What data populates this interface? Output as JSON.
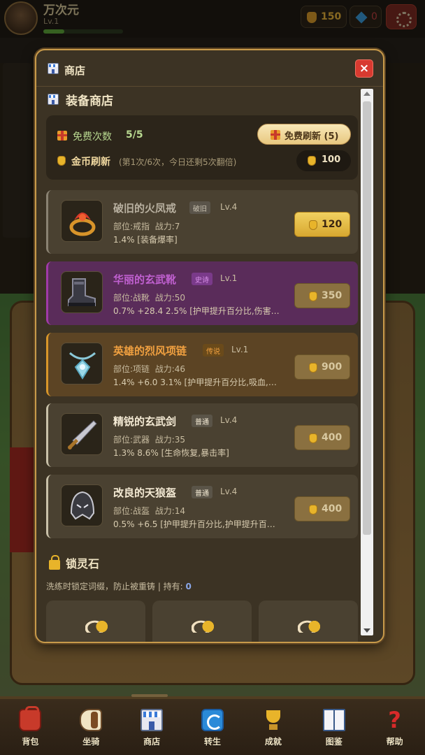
{
  "header": {
    "player_name": "万次元",
    "player_level": "Lv.1",
    "gold": "150",
    "gems": "0"
  },
  "modal": {
    "title": "商店",
    "close_label": "×",
    "equipment_shop": {
      "title": "装备商店",
      "free_label": "免费次数",
      "free_count": "5/5",
      "free_refresh_button": "免费刷新 (5)",
      "coin_refresh_label": "金币刷新",
      "coin_refresh_note": "(第1次/6次，今日还剩5次翻倍)",
      "coin_refresh_cost": "100"
    },
    "items": [
      {
        "name": "破旧的火凤戒",
        "rarity": "破旧",
        "level": "Lv.4",
        "slot": "部位:戒指",
        "power": "战力:7",
        "affix": "1.4% [装备爆率]",
        "price": "120",
        "icon": "ring-icon"
      },
      {
        "name": "华丽的玄武靴",
        "rarity": "史诗",
        "level": "Lv.1",
        "slot": "部位:战靴",
        "power": "战力:50",
        "affix": "0.7% +28.4 2.5% [护甲提升百分比,伤害…",
        "price": "350",
        "icon": "boots-icon"
      },
      {
        "name": "英雄的烈风项链",
        "rarity": "传说",
        "level": "Lv.1",
        "slot": "部位:项链",
        "power": "战力:46",
        "affix": "1.4% +6.0 3.1% [护甲提升百分比,吸血,伤…",
        "price": "900",
        "icon": "necklace-icon"
      },
      {
        "name": "精锐的玄武剑",
        "rarity": "普通",
        "level": "Lv.4",
        "slot": "部位:武器",
        "power": "战力:35",
        "affix": "1.3% 8.6% [生命恢复,暴击率]",
        "price": "400",
        "icon": "sword-icon"
      },
      {
        "name": "改良的天狼盔",
        "rarity": "普通",
        "level": "Lv.4",
        "slot": "部位:战盔",
        "power": "战力:14",
        "affix": "0.5% +6.5 [护甲提升百分比,护甲提升百…",
        "price": "400",
        "icon": "helmet-icon"
      }
    ],
    "lock_stone": {
      "title": "锁灵石",
      "description": "洗练时锁定词缀，防止被重铸 | 持有: ",
      "owned": "0"
    }
  },
  "bottom_nav": [
    {
      "label": "背包",
      "icon": "backpack-icon"
    },
    {
      "label": "坐骑",
      "icon": "horse-icon"
    },
    {
      "label": "商店",
      "icon": "shop-icon"
    },
    {
      "label": "转生",
      "icon": "rebirth-icon"
    },
    {
      "label": "成就",
      "icon": "trophy-icon"
    },
    {
      "label": "图鉴",
      "icon": "book-icon"
    },
    {
      "label": "帮助",
      "icon": "help-icon"
    }
  ],
  "colors": {
    "accent_gold": "#e8b42a",
    "epic": "#c060d0",
    "legendary": "#f0a040",
    "close_red": "#d83a30"
  }
}
